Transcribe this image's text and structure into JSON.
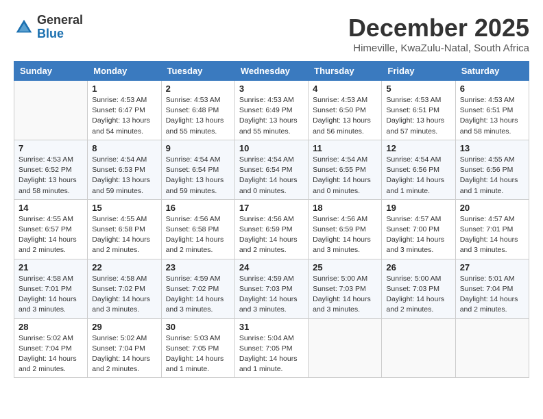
{
  "logo": {
    "general": "General",
    "blue": "Blue"
  },
  "header": {
    "month": "December 2025",
    "location": "Himeville, KwaZulu-Natal, South Africa"
  },
  "days_of_week": [
    "Sunday",
    "Monday",
    "Tuesday",
    "Wednesday",
    "Thursday",
    "Friday",
    "Saturday"
  ],
  "weeks": [
    [
      {
        "day": "",
        "info": ""
      },
      {
        "day": "1",
        "info": "Sunrise: 4:53 AM\nSunset: 6:47 PM\nDaylight: 13 hours\nand 54 minutes."
      },
      {
        "day": "2",
        "info": "Sunrise: 4:53 AM\nSunset: 6:48 PM\nDaylight: 13 hours\nand 55 minutes."
      },
      {
        "day": "3",
        "info": "Sunrise: 4:53 AM\nSunset: 6:49 PM\nDaylight: 13 hours\nand 55 minutes."
      },
      {
        "day": "4",
        "info": "Sunrise: 4:53 AM\nSunset: 6:50 PM\nDaylight: 13 hours\nand 56 minutes."
      },
      {
        "day": "5",
        "info": "Sunrise: 4:53 AM\nSunset: 6:51 PM\nDaylight: 13 hours\nand 57 minutes."
      },
      {
        "day": "6",
        "info": "Sunrise: 4:53 AM\nSunset: 6:51 PM\nDaylight: 13 hours\nand 58 minutes."
      }
    ],
    [
      {
        "day": "7",
        "info": "Sunrise: 4:53 AM\nSunset: 6:52 PM\nDaylight: 13 hours\nand 58 minutes."
      },
      {
        "day": "8",
        "info": "Sunrise: 4:54 AM\nSunset: 6:53 PM\nDaylight: 13 hours\nand 59 minutes."
      },
      {
        "day": "9",
        "info": "Sunrise: 4:54 AM\nSunset: 6:54 PM\nDaylight: 13 hours\nand 59 minutes."
      },
      {
        "day": "10",
        "info": "Sunrise: 4:54 AM\nSunset: 6:54 PM\nDaylight: 14 hours\nand 0 minutes."
      },
      {
        "day": "11",
        "info": "Sunrise: 4:54 AM\nSunset: 6:55 PM\nDaylight: 14 hours\nand 0 minutes."
      },
      {
        "day": "12",
        "info": "Sunrise: 4:54 AM\nSunset: 6:56 PM\nDaylight: 14 hours\nand 1 minute."
      },
      {
        "day": "13",
        "info": "Sunrise: 4:55 AM\nSunset: 6:56 PM\nDaylight: 14 hours\nand 1 minute."
      }
    ],
    [
      {
        "day": "14",
        "info": "Sunrise: 4:55 AM\nSunset: 6:57 PM\nDaylight: 14 hours\nand 2 minutes."
      },
      {
        "day": "15",
        "info": "Sunrise: 4:55 AM\nSunset: 6:58 PM\nDaylight: 14 hours\nand 2 minutes."
      },
      {
        "day": "16",
        "info": "Sunrise: 4:56 AM\nSunset: 6:58 PM\nDaylight: 14 hours\nand 2 minutes."
      },
      {
        "day": "17",
        "info": "Sunrise: 4:56 AM\nSunset: 6:59 PM\nDaylight: 14 hours\nand 2 minutes."
      },
      {
        "day": "18",
        "info": "Sunrise: 4:56 AM\nSunset: 6:59 PM\nDaylight: 14 hours\nand 3 minutes."
      },
      {
        "day": "19",
        "info": "Sunrise: 4:57 AM\nSunset: 7:00 PM\nDaylight: 14 hours\nand 3 minutes."
      },
      {
        "day": "20",
        "info": "Sunrise: 4:57 AM\nSunset: 7:01 PM\nDaylight: 14 hours\nand 3 minutes."
      }
    ],
    [
      {
        "day": "21",
        "info": "Sunrise: 4:58 AM\nSunset: 7:01 PM\nDaylight: 14 hours\nand 3 minutes."
      },
      {
        "day": "22",
        "info": "Sunrise: 4:58 AM\nSunset: 7:02 PM\nDaylight: 14 hours\nand 3 minutes."
      },
      {
        "day": "23",
        "info": "Sunrise: 4:59 AM\nSunset: 7:02 PM\nDaylight: 14 hours\nand 3 minutes."
      },
      {
        "day": "24",
        "info": "Sunrise: 4:59 AM\nSunset: 7:03 PM\nDaylight: 14 hours\nand 3 minutes."
      },
      {
        "day": "25",
        "info": "Sunrise: 5:00 AM\nSunset: 7:03 PM\nDaylight: 14 hours\nand 3 minutes."
      },
      {
        "day": "26",
        "info": "Sunrise: 5:00 AM\nSunset: 7:03 PM\nDaylight: 14 hours\nand 2 minutes."
      },
      {
        "day": "27",
        "info": "Sunrise: 5:01 AM\nSunset: 7:04 PM\nDaylight: 14 hours\nand 2 minutes."
      }
    ],
    [
      {
        "day": "28",
        "info": "Sunrise: 5:02 AM\nSunset: 7:04 PM\nDaylight: 14 hours\nand 2 minutes."
      },
      {
        "day": "29",
        "info": "Sunrise: 5:02 AM\nSunset: 7:04 PM\nDaylight: 14 hours\nand 2 minutes."
      },
      {
        "day": "30",
        "info": "Sunrise: 5:03 AM\nSunset: 7:05 PM\nDaylight: 14 hours\nand 1 minute."
      },
      {
        "day": "31",
        "info": "Sunrise: 5:04 AM\nSunset: 7:05 PM\nDaylight: 14 hours\nand 1 minute."
      },
      {
        "day": "",
        "info": ""
      },
      {
        "day": "",
        "info": ""
      },
      {
        "day": "",
        "info": ""
      }
    ]
  ]
}
